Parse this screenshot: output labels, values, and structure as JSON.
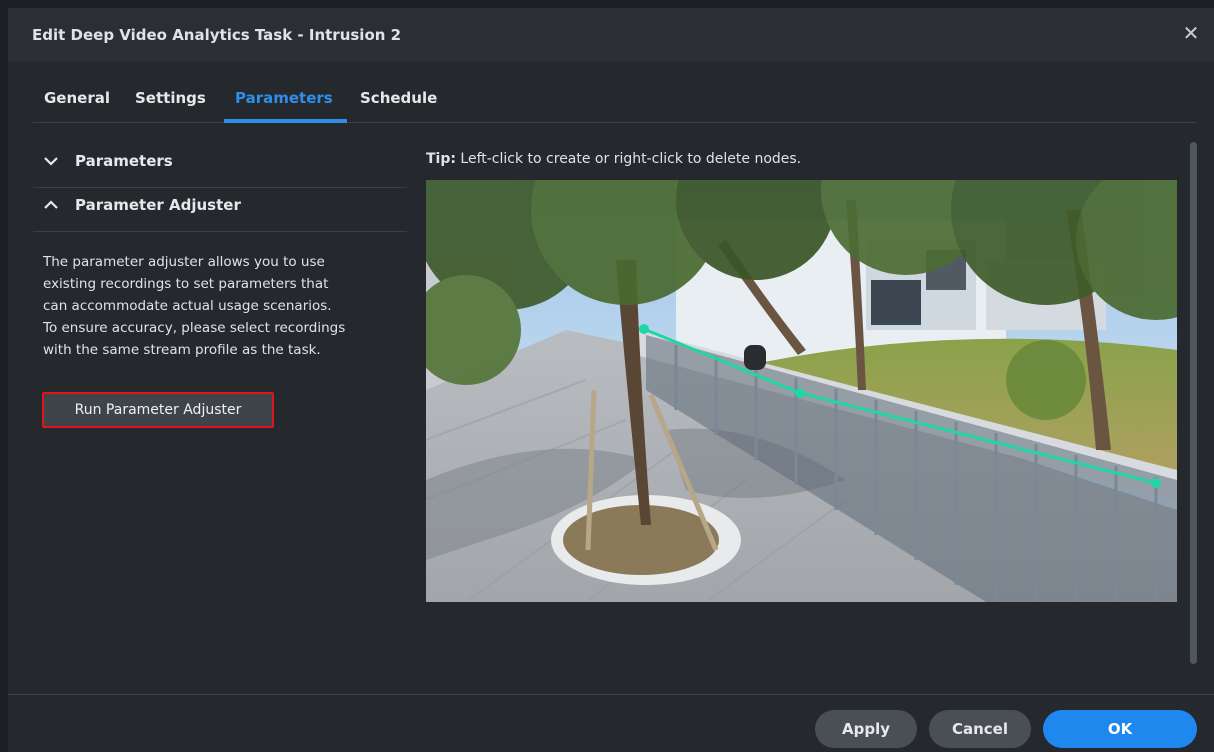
{
  "dialog": {
    "title": "Edit Deep Video Analytics Task - Intrusion 2",
    "close_label": "✕"
  },
  "tabs": [
    {
      "label": "General"
    },
    {
      "label": "Settings"
    },
    {
      "label": "Parameters",
      "active": true
    },
    {
      "label": "Schedule"
    }
  ],
  "sections": {
    "parameters": {
      "label": "Parameters",
      "expanded": false
    },
    "adjuster": {
      "label": "Parameter Adjuster",
      "expanded": true,
      "description_lines": [
        "The parameter adjuster allows you to use",
        "existing recordings to set parameters that",
        "can accommodate actual usage scenarios.",
        "To ensure accuracy, please select recordings",
        "with the same stream profile as the task."
      ],
      "run_button": "Run Parameter Adjuster"
    }
  },
  "tip": {
    "prefix": "Tip:",
    "text": " Left-click to create or right-click to delete nodes."
  },
  "footer": {
    "apply": "Apply",
    "cancel": "Cancel",
    "ok": "OK"
  },
  "colors": {
    "accent": "#2f8ee8",
    "ok_button": "#1f88ee",
    "highlight_border": "#e0141b",
    "detection_line": "#1fd6a4"
  }
}
